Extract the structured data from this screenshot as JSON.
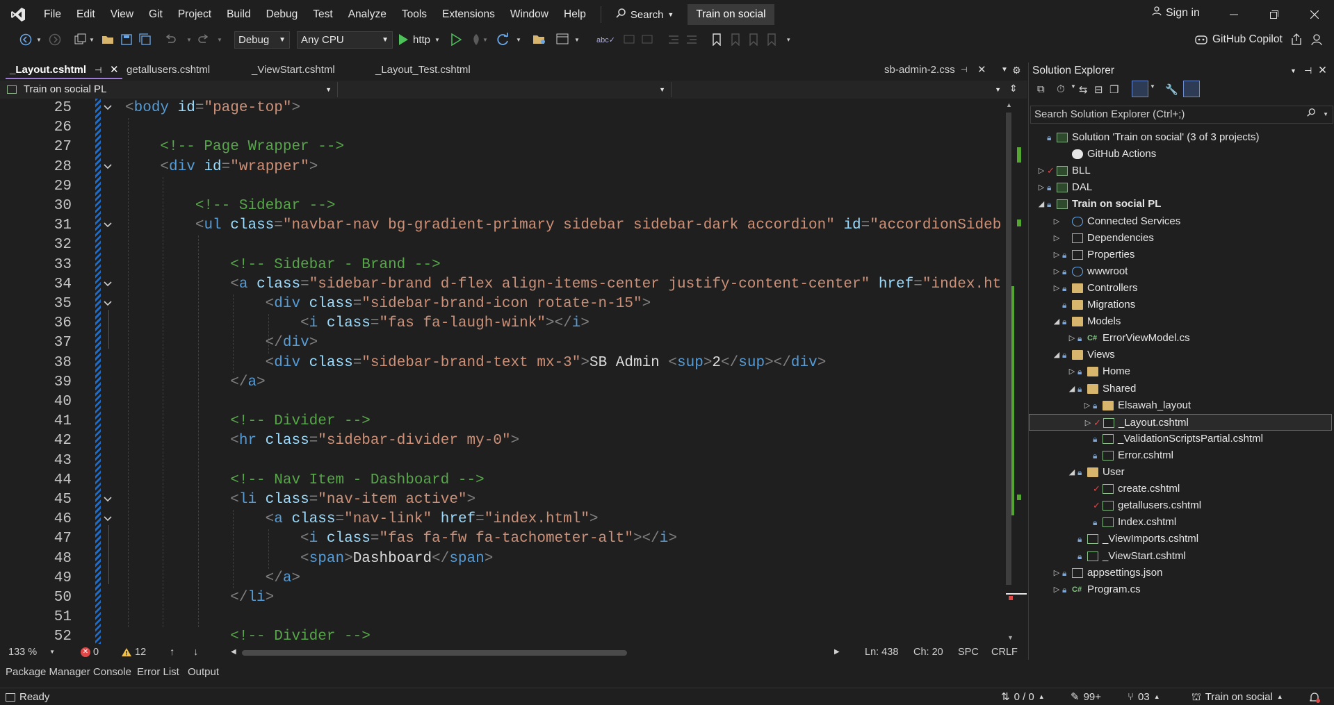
{
  "menu": [
    "File",
    "Edit",
    "View",
    "Git",
    "Project",
    "Build",
    "Debug",
    "Test",
    "Analyze",
    "Tools",
    "Extensions",
    "Window",
    "Help"
  ],
  "search_label": "Search",
  "project_title": "Train on social",
  "signin_label": "Sign in",
  "copilot_label": "GitHub Copilot",
  "toolbar": {
    "config": "Debug",
    "platform": "Any CPU",
    "run_label": "http"
  },
  "tabs": [
    {
      "label": "_Layout.cshtml",
      "active": true
    },
    {
      "label": "getallusers.cshtml"
    },
    {
      "label": "_ViewStart.cshtml"
    },
    {
      "label": "_Layout_Test.cshtml"
    },
    {
      "label": "sb-admin-2.css"
    }
  ],
  "navbar": {
    "project": "Train on social PL",
    "scope": "",
    "member": ""
  },
  "editor": {
    "lines": [
      {
        "n": "25",
        "parts": [
          [
            "t-punc",
            "<"
          ],
          [
            "t-tag",
            "body"
          ],
          [
            "t-txt",
            " "
          ],
          [
            "t-attr",
            "id"
          ],
          [
            "t-punc",
            "="
          ],
          [
            "t-str",
            "\"page-top\""
          ],
          [
            "t-punc",
            ">"
          ]
        ]
      },
      {
        "n": "26",
        "parts": []
      },
      {
        "n": "27",
        "parts": [
          [
            "t-txt",
            "    "
          ],
          [
            "t-com",
            "<!-- Page Wrapper -->"
          ]
        ]
      },
      {
        "n": "28",
        "parts": [
          [
            "t-txt",
            "    "
          ],
          [
            "t-punc",
            "<"
          ],
          [
            "t-tag",
            "div"
          ],
          [
            "t-txt",
            " "
          ],
          [
            "t-attr",
            "id"
          ],
          [
            "t-punc",
            "="
          ],
          [
            "t-str",
            "\"wrapper\""
          ],
          [
            "t-punc",
            ">"
          ]
        ]
      },
      {
        "n": "29",
        "parts": []
      },
      {
        "n": "30",
        "parts": [
          [
            "t-txt",
            "        "
          ],
          [
            "t-com",
            "<!-- Sidebar -->"
          ]
        ]
      },
      {
        "n": "31",
        "parts": [
          [
            "t-txt",
            "        "
          ],
          [
            "t-punc",
            "<"
          ],
          [
            "t-tag",
            "ul"
          ],
          [
            "t-txt",
            " "
          ],
          [
            "t-attr",
            "class"
          ],
          [
            "t-punc",
            "="
          ],
          [
            "t-str",
            "\"navbar-nav bg-gradient-primary sidebar sidebar-dark accordion\""
          ],
          [
            "t-txt",
            " "
          ],
          [
            "t-attr",
            "id"
          ],
          [
            "t-punc",
            "="
          ],
          [
            "t-str",
            "\"accordionSideb"
          ]
        ]
      },
      {
        "n": "32",
        "parts": []
      },
      {
        "n": "33",
        "parts": [
          [
            "t-txt",
            "            "
          ],
          [
            "t-com",
            "<!-- Sidebar - Brand -->"
          ]
        ]
      },
      {
        "n": "34",
        "parts": [
          [
            "t-txt",
            "            "
          ],
          [
            "t-punc",
            "<"
          ],
          [
            "t-tag",
            "a"
          ],
          [
            "t-txt",
            " "
          ],
          [
            "t-attr",
            "class"
          ],
          [
            "t-punc",
            "="
          ],
          [
            "t-str",
            "\"sidebar-brand d-flex align-items-center justify-content-center\""
          ],
          [
            "t-txt",
            " "
          ],
          [
            "t-attr",
            "href"
          ],
          [
            "t-punc",
            "="
          ],
          [
            "t-str",
            "\"index.ht"
          ]
        ]
      },
      {
        "n": "35",
        "parts": [
          [
            "t-txt",
            "                "
          ],
          [
            "t-punc",
            "<"
          ],
          [
            "t-tag",
            "div"
          ],
          [
            "t-txt",
            " "
          ],
          [
            "t-attr",
            "class"
          ],
          [
            "t-punc",
            "="
          ],
          [
            "t-str",
            "\"sidebar-brand-icon rotate-n-15\""
          ],
          [
            "t-punc",
            ">"
          ]
        ]
      },
      {
        "n": "36",
        "parts": [
          [
            "t-txt",
            "                    "
          ],
          [
            "t-punc",
            "<"
          ],
          [
            "t-tag",
            "i"
          ],
          [
            "t-txt",
            " "
          ],
          [
            "t-attr",
            "class"
          ],
          [
            "t-punc",
            "="
          ],
          [
            "t-str",
            "\"fas fa-laugh-wink\""
          ],
          [
            "t-punc",
            "></"
          ],
          [
            "t-tag",
            "i"
          ],
          [
            "t-punc",
            ">"
          ]
        ]
      },
      {
        "n": "37",
        "parts": [
          [
            "t-txt",
            "                "
          ],
          [
            "t-punc",
            "</"
          ],
          [
            "t-tag",
            "div"
          ],
          [
            "t-punc",
            ">"
          ]
        ]
      },
      {
        "n": "38",
        "parts": [
          [
            "t-txt",
            "                "
          ],
          [
            "t-punc",
            "<"
          ],
          [
            "t-tag",
            "div"
          ],
          [
            "t-txt",
            " "
          ],
          [
            "t-attr",
            "class"
          ],
          [
            "t-punc",
            "="
          ],
          [
            "t-str",
            "\"sidebar-brand-text mx-3\""
          ],
          [
            "t-punc",
            ">"
          ],
          [
            "t-txt",
            "SB Admin "
          ],
          [
            "t-punc",
            "<"
          ],
          [
            "t-tag",
            "sup"
          ],
          [
            "t-punc",
            ">"
          ],
          [
            "t-txt",
            "2"
          ],
          [
            "t-punc",
            "</"
          ],
          [
            "t-tag",
            "sup"
          ],
          [
            "t-punc",
            "></"
          ],
          [
            "t-tag",
            "div"
          ],
          [
            "t-punc",
            ">"
          ]
        ]
      },
      {
        "n": "39",
        "parts": [
          [
            "t-txt",
            "            "
          ],
          [
            "t-punc",
            "</"
          ],
          [
            "t-tag",
            "a"
          ],
          [
            "t-punc",
            ">"
          ]
        ]
      },
      {
        "n": "40",
        "parts": []
      },
      {
        "n": "41",
        "parts": [
          [
            "t-txt",
            "            "
          ],
          [
            "t-com",
            "<!-- Divider -->"
          ]
        ]
      },
      {
        "n": "42",
        "parts": [
          [
            "t-txt",
            "            "
          ],
          [
            "t-punc",
            "<"
          ],
          [
            "t-tag",
            "hr"
          ],
          [
            "t-txt",
            " "
          ],
          [
            "t-attr",
            "class"
          ],
          [
            "t-punc",
            "="
          ],
          [
            "t-str",
            "\"sidebar-divider my-0\""
          ],
          [
            "t-punc",
            ">"
          ]
        ]
      },
      {
        "n": "43",
        "parts": []
      },
      {
        "n": "44",
        "parts": [
          [
            "t-txt",
            "            "
          ],
          [
            "t-com",
            "<!-- Nav Item - Dashboard -->"
          ]
        ]
      },
      {
        "n": "45",
        "parts": [
          [
            "t-txt",
            "            "
          ],
          [
            "t-punc",
            "<"
          ],
          [
            "t-tag",
            "li"
          ],
          [
            "t-txt",
            " "
          ],
          [
            "t-attr",
            "class"
          ],
          [
            "t-punc",
            "="
          ],
          [
            "t-str",
            "\"nav-item active\""
          ],
          [
            "t-punc",
            ">"
          ]
        ]
      },
      {
        "n": "46",
        "parts": [
          [
            "t-txt",
            "                "
          ],
          [
            "t-punc",
            "<"
          ],
          [
            "t-tag",
            "a"
          ],
          [
            "t-txt",
            " "
          ],
          [
            "t-attr",
            "class"
          ],
          [
            "t-punc",
            "="
          ],
          [
            "t-str",
            "\"nav-link\""
          ],
          [
            "t-txt",
            " "
          ],
          [
            "t-attr",
            "href"
          ],
          [
            "t-punc",
            "="
          ],
          [
            "t-str",
            "\"index.html\""
          ],
          [
            "t-punc",
            ">"
          ]
        ]
      },
      {
        "n": "47",
        "parts": [
          [
            "t-txt",
            "                    "
          ],
          [
            "t-punc",
            "<"
          ],
          [
            "t-tag",
            "i"
          ],
          [
            "t-txt",
            " "
          ],
          [
            "t-attr",
            "class"
          ],
          [
            "t-punc",
            "="
          ],
          [
            "t-str",
            "\"fas fa-fw fa-tachometer-alt\""
          ],
          [
            "t-punc",
            "></"
          ],
          [
            "t-tag",
            "i"
          ],
          [
            "t-punc",
            ">"
          ]
        ]
      },
      {
        "n": "48",
        "parts": [
          [
            "t-txt",
            "                    "
          ],
          [
            "t-punc",
            "<"
          ],
          [
            "t-tag",
            "span"
          ],
          [
            "t-punc",
            ">"
          ],
          [
            "t-txt",
            "Dashboard"
          ],
          [
            "t-punc",
            "</"
          ],
          [
            "t-tag",
            "span"
          ],
          [
            "t-punc",
            ">"
          ]
        ]
      },
      {
        "n": "49",
        "parts": [
          [
            "t-txt",
            "                "
          ],
          [
            "t-punc",
            "</"
          ],
          [
            "t-tag",
            "a"
          ],
          [
            "t-punc",
            ">"
          ]
        ]
      },
      {
        "n": "50",
        "parts": [
          [
            "t-txt",
            "            "
          ],
          [
            "t-punc",
            "</"
          ],
          [
            "t-tag",
            "li"
          ],
          [
            "t-punc",
            ">"
          ]
        ]
      },
      {
        "n": "51",
        "parts": []
      },
      {
        "n": "52",
        "parts": [
          [
            "t-txt",
            "            "
          ],
          [
            "t-com",
            "<!-- Divider -->"
          ]
        ]
      }
    ]
  },
  "editor_status": {
    "zoom": "133 %",
    "errors": "0",
    "warnings": "12",
    "position": "Ln: 438",
    "column": "Ch: 20",
    "whitespace": "SPC",
    "line_ending": "CRLF"
  },
  "bottom_tabs": [
    "Package Manager Console",
    "Error List",
    "Output"
  ],
  "statusbar": {
    "ready": "Ready",
    "sync": "0 / 0",
    "edits": "99+",
    "branch": "03",
    "repo": "Train on social"
  },
  "solution_explorer": {
    "title": "Solution Explorer",
    "search_placeholder": "Search Solution Explorer (Ctrl+;)",
    "tree": [
      {
        "label": "Solution 'Train on social' (3 of 3 projects)",
        "depth": 0,
        "exp": "",
        "icon": "solution-icon",
        "lock": true
      },
      {
        "label": "GitHub Actions",
        "depth": 1,
        "exp": "",
        "icon": "github-icon"
      },
      {
        "label": "BLL",
        "depth": 0,
        "exp": "▷",
        "icon": "project-icon",
        "lock": false,
        "check": true
      },
      {
        "label": "DAL",
        "depth": 0,
        "exp": "▷",
        "icon": "project-icon",
        "lock": true
      },
      {
        "label": "Train on social PL",
        "depth": 0,
        "exp": "◢",
        "icon": "web-project-icon",
        "lock": true,
        "bold": true
      },
      {
        "label": "Connected Services",
        "depth": 1,
        "exp": "▷",
        "icon": "cloud-icon"
      },
      {
        "label": "Dependencies",
        "depth": 1,
        "exp": "▷",
        "icon": "dependencies-icon"
      },
      {
        "label": "Properties",
        "depth": 1,
        "exp": "▷",
        "icon": "properties-icon",
        "lock": true
      },
      {
        "label": "wwwroot",
        "depth": 1,
        "exp": "▷",
        "icon": "globe-icon",
        "lock": true
      },
      {
        "label": "Controllers",
        "depth": 1,
        "exp": "▷",
        "icon": "folder-icon",
        "lock": true
      },
      {
        "label": "Migrations",
        "depth": 1,
        "exp": "",
        "icon": "folder-icon",
        "lock": true
      },
      {
        "label": "Models",
        "depth": 1,
        "exp": "◢",
        "icon": "folder-icon",
        "lock": true
      },
      {
        "label": "ErrorViewModel.cs",
        "depth": 2,
        "exp": "▷",
        "icon": "csharp-icon",
        "lock": true
      },
      {
        "label": "Views",
        "depth": 1,
        "exp": "◢",
        "icon": "folder-icon",
        "lock": true
      },
      {
        "label": "Home",
        "depth": 2,
        "exp": "▷",
        "icon": "folder-icon",
        "lock": true
      },
      {
        "label": "Shared",
        "depth": 2,
        "exp": "◢",
        "icon": "folder-icon",
        "lock": true
      },
      {
        "label": "Elsawah_layout",
        "depth": 3,
        "exp": "▷",
        "icon": "folder-icon",
        "lock": true
      },
      {
        "label": "_Layout.cshtml",
        "depth": 3,
        "exp": "▷",
        "icon": "cshtml-icon",
        "lock": false,
        "check": true,
        "selected": true
      },
      {
        "label": "_ValidationScriptsPartial.cshtml",
        "depth": 3,
        "exp": "",
        "icon": "cshtml-icon",
        "lock": true
      },
      {
        "label": "Error.cshtml",
        "depth": 3,
        "exp": "",
        "icon": "cshtml-icon",
        "lock": true
      },
      {
        "label": "User",
        "depth": 2,
        "exp": "◢",
        "icon": "folder-icon",
        "lock": true
      },
      {
        "label": "create.cshtml",
        "depth": 3,
        "exp": "",
        "icon": "cshtml-icon",
        "lock": false,
        "check": true
      },
      {
        "label": "getallusers.cshtml",
        "depth": 3,
        "exp": "",
        "icon": "cshtml-icon",
        "lock": false,
        "check": true
      },
      {
        "label": "Index.cshtml",
        "depth": 3,
        "exp": "",
        "icon": "cshtml-icon",
        "lock": true
      },
      {
        "label": "_ViewImports.cshtml",
        "depth": 2,
        "exp": "",
        "icon": "cshtml-icon",
        "lock": true
      },
      {
        "label": "_ViewStart.cshtml",
        "depth": 2,
        "exp": "",
        "icon": "cshtml-icon",
        "lock": true
      },
      {
        "label": "appsettings.json",
        "depth": 1,
        "exp": "▷",
        "icon": "json-icon",
        "lock": true
      },
      {
        "label": "Program.cs",
        "depth": 1,
        "exp": "▷",
        "icon": "csharp-icon",
        "lock": true
      }
    ]
  },
  "colors": {
    "accent": "#9d7bd6",
    "change_bar": "#1e6cc8",
    "error": "#e04848",
    "warning": "#f0c048",
    "comment": "#57a64a",
    "tag": "#569cd6",
    "attr": "#9cdcfe",
    "string": "#ce9178"
  }
}
